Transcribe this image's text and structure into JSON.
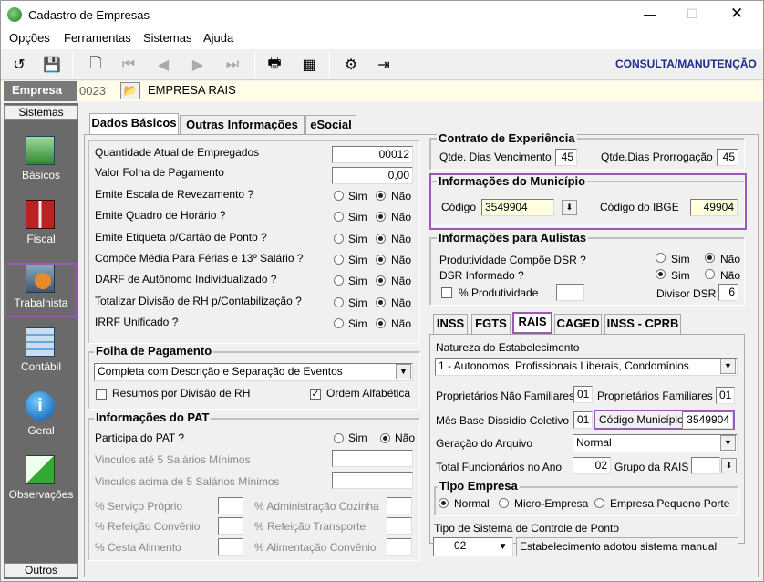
{
  "window": {
    "title": "Cadastro de Empresas"
  },
  "menu": [
    "Opções",
    "Ferramentas",
    "Sistemas",
    "Ajuda"
  ],
  "toolbar": {
    "mode": "CONSULTA/MANUTENÇÃO"
  },
  "empresa": {
    "label": "Empresa",
    "code": "0023",
    "name": "EMPRESA RAIS"
  },
  "sidebar": {
    "top_label": "Sistemas",
    "bottom_label": "Outros",
    "items": [
      "Básicos",
      "Fiscal",
      "Trabalhista",
      "Contábil",
      "Geral",
      "Observações"
    ]
  },
  "tabs": [
    "Dados Básicos",
    "Outras Informações",
    "eSocial"
  ],
  "basic": {
    "qtd_empregados_label": "Quantidade Atual de Empregados",
    "qtd_empregados": "00012",
    "valor_folha_label": "Valor Folha de Pagamento",
    "valor_folha": "0,00",
    "questions": [
      "Emite Escala de Revezamento ?",
      "Emite Quadro de Horário ?",
      "Emite Etiqueta p/Cartão de Ponto ?",
      "Compõe Média Para Férias e 13º Salário ?",
      "DARF de Autônomo Individualizado ?",
      "Totalizar Divisão de RH p/Contabilização ?",
      "IRRF Unificado ?"
    ],
    "sim": "Sim",
    "nao": "Não"
  },
  "folha": {
    "title": "Folha de Pagamento",
    "value": "Completa com Descrição e Separação de Eventos",
    "resumos": "Resumos por Divisão de RH",
    "ordem": "Ordem Alfabética"
  },
  "pat": {
    "title": "Informações do PAT",
    "participa": "Participa do PAT ?",
    "vinc5": "Vinculos até 5 Salários Mínimos",
    "vincacima": "Vinculos acima de 5 Salários Mínimos",
    "servico": "% Serviço Próprio",
    "admcoz": "% Administração Cozinha",
    "refconv": "% Refeição Convênio",
    "reftransp": "% Refeição Transporte",
    "cesta": "% Cesta Alimento",
    "alimconv": "% Alimentação Convênio"
  },
  "contrato": {
    "title": "Contrato de Experiência",
    "venc_label": "Qtde. Dias Vencimento",
    "venc": "45",
    "prorr_label": "Qtde.Dias Prorrogação",
    "prorr": "45"
  },
  "municipio": {
    "title": "Informações do Município",
    "codigo_label": "Código",
    "codigo": "3549904",
    "ibge_label": "Código do IBGE",
    "ibge": "49904"
  },
  "aulistas": {
    "title": "Informações para Aulistas",
    "prod": "Produtividade Compõe DSR ?",
    "dsr": "DSR Informado ?",
    "pct": "% Produtividade",
    "divisor_label": "Divisor DSR",
    "divisor": "6"
  },
  "subtabs": [
    "INSS",
    "FGTS",
    "RAIS",
    "CAGED",
    "INSS - CPRB"
  ],
  "rais": {
    "natureza_label": "Natureza do Estabelecimento",
    "natureza": "1 - Autonomos, Profissionais Liberais, Condomínios",
    "propnf_label": "Proprietários Não Familiares",
    "propnf": "01",
    "propf_label": "Proprietários Familiares",
    "propf": "01",
    "mes_label": "Mês Base Dissídio Coletivo",
    "mes": "01",
    "codmun_label": "Código Município",
    "codmun": "3549904",
    "geracao_label": "Geração do  Arquivo",
    "geracao": "Normal",
    "total_label": "Total Funcionários no Ano",
    "total": "02",
    "grupo_label": "Grupo da RAIS"
  },
  "tipo": {
    "title": "Tipo Empresa",
    "normal": "Normal",
    "micro": "Micro-Empresa",
    "peq": "Empresa Pequeno Porte"
  },
  "ponto": {
    "label": "Tipo de Sistema de Controle de Ponto",
    "code": "02",
    "desc": "Estabelecimento adotou sistema manual"
  },
  "colors": {
    "accent": "#9b59b6",
    "mode_text": "#1f2a8a"
  }
}
